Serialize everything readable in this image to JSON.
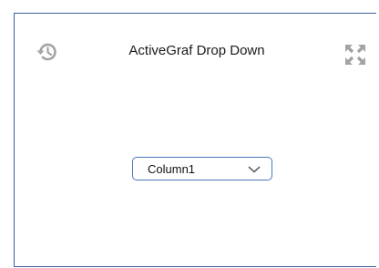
{
  "widget": {
    "title": "ActiveGraf Drop Down",
    "icons": {
      "history": "history-icon",
      "expand": "expand-icon",
      "dropdown_arrow": "chevron-down-icon"
    },
    "dropdown": {
      "selected": "Column1"
    },
    "colors": {
      "frame_border": "#3e5f9c",
      "dropdown_border": "#4a78b8",
      "icon_gray": "#a3a3a3"
    }
  }
}
